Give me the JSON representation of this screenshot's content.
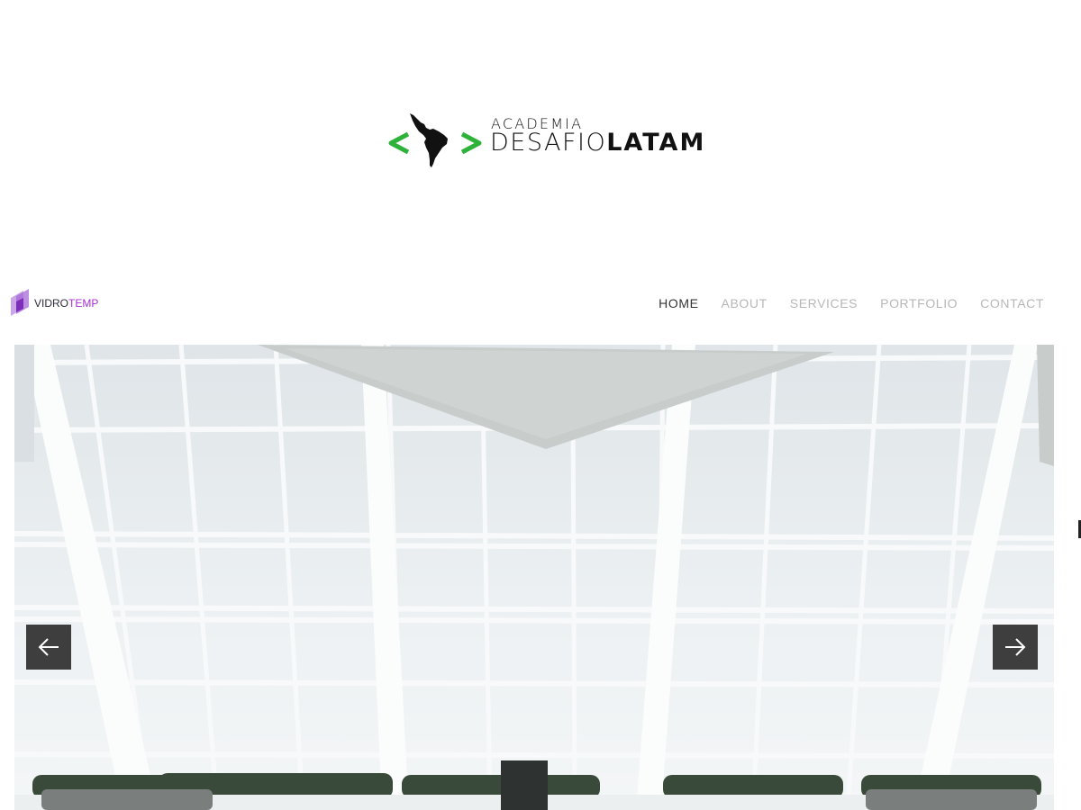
{
  "brand": {
    "line1": "ACADEMIA",
    "line2_light": "DESAFIO",
    "line2_bold": "LATAM",
    "bracket_color": "#2fb23a"
  },
  "site": {
    "logo": {
      "name_part1": "VIDRO",
      "name_part2": "TEMP",
      "accent_color": "#a62ed8"
    },
    "nav": {
      "items": [
        {
          "label": "HOME",
          "active": true
        },
        {
          "label": "ABOUT",
          "active": false
        },
        {
          "label": "SERVICES",
          "active": false
        },
        {
          "label": "PORTFOLIO",
          "active": false
        },
        {
          "label": "CONTACT",
          "active": false
        }
      ]
    }
  },
  "hero": {
    "image_icon": "glass-roof-atrium-photo",
    "prev_icon": "arrow-left-icon",
    "next_icon": "arrow-right-icon"
  }
}
